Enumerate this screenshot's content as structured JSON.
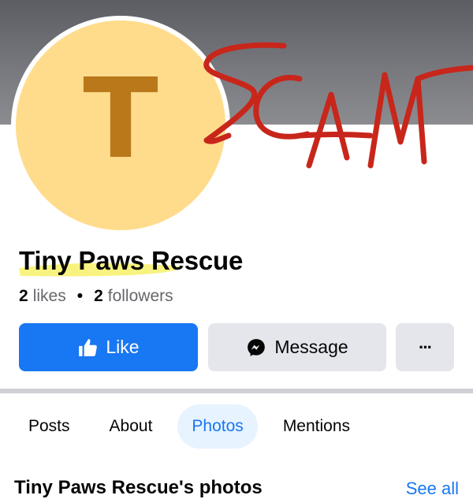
{
  "page": {
    "avatar_letter": "T",
    "name": "Tiny Paws Rescue",
    "likes_count": "2",
    "likes_label": "likes",
    "separator": "•",
    "followers_count": "2",
    "followers_label": "followers"
  },
  "actions": {
    "like_label": "Like",
    "like_icon": "thumbs-up-icon",
    "message_label": "Message",
    "message_icon": "messenger-icon",
    "more_label": "···",
    "more_icon": "more-icon"
  },
  "tabs": [
    {
      "label": "Posts",
      "active": false
    },
    {
      "label": "About",
      "active": false
    },
    {
      "label": "Photos",
      "active": true
    },
    {
      "label": "Mentions",
      "active": false
    }
  ],
  "photos_section": {
    "title": "Tiny Paws Rescue's photos",
    "see_all": "See all"
  },
  "annotation": {
    "handwritten_text": "SCAM",
    "color": "#c8261b"
  },
  "colors": {
    "accent": "#1877f2",
    "avatar_bg": "#ffdc8c",
    "avatar_letter": "#b9781a",
    "button_gray": "#e4e6eb",
    "highlight": "#f7f16a"
  }
}
